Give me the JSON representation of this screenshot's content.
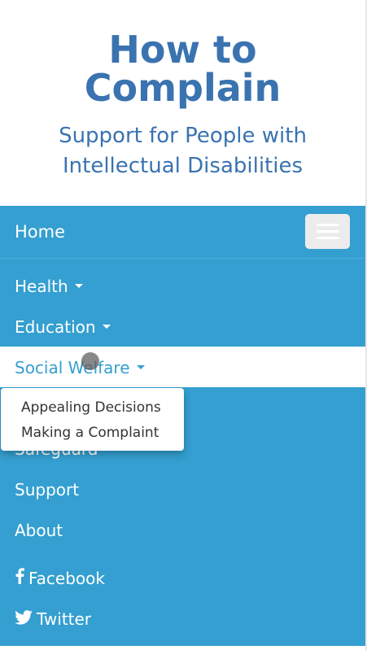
{
  "header": {
    "title_line1": "How to",
    "title_line2": "Complain",
    "subtitle_line1": "Support for People with",
    "subtitle_line2": "Intellectual Disabilities"
  },
  "navbar": {
    "brand": "Home",
    "toggle_icon": "hamburger-icon",
    "items": [
      {
        "label": "Health",
        "dropdown": true
      },
      {
        "label": "Education",
        "dropdown": true
      },
      {
        "label": "Social Welfare",
        "dropdown": true,
        "active": true
      },
      {
        "label": "Safeguard",
        "dropdown": true
      },
      {
        "label": "Support"
      },
      {
        "label": "About"
      }
    ],
    "social": [
      {
        "label": "Facebook",
        "icon": "facebook-icon"
      },
      {
        "label": "Twitter",
        "icon": "twitter-icon"
      }
    ]
  },
  "dropdown": {
    "items": [
      "Appealing Decisions",
      "Making a Complaint"
    ]
  },
  "colors": {
    "nav_bg": "#349fd0",
    "title": "#3a73b0",
    "active_text": "#349fd0"
  }
}
